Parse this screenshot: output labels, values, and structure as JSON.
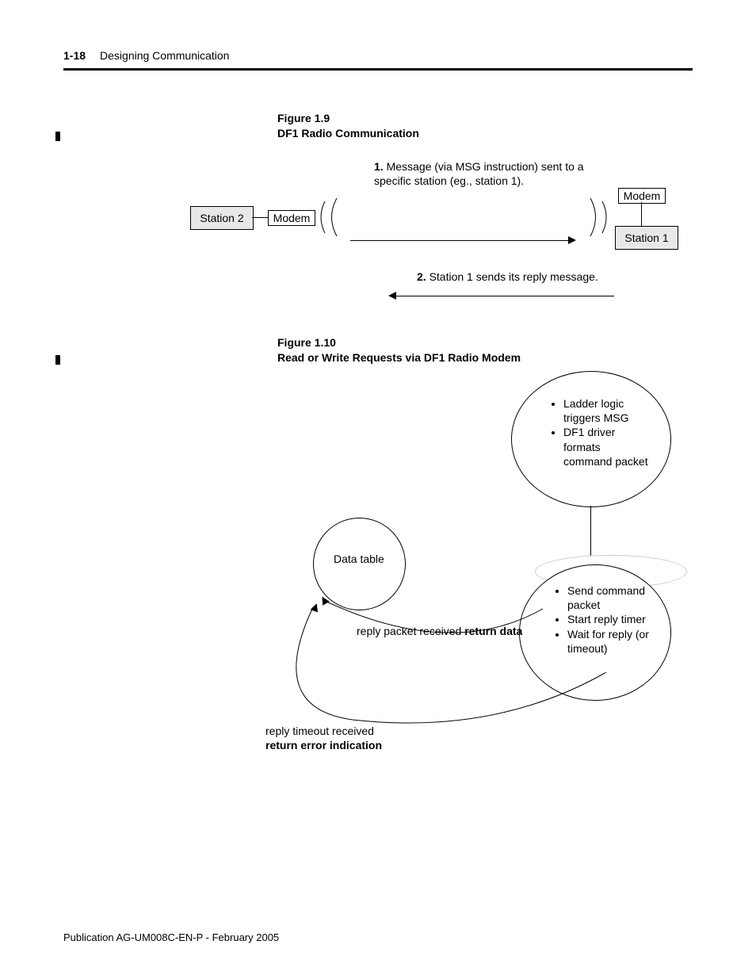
{
  "header": {
    "page": "1-18",
    "section": "Designing Communication"
  },
  "fig19": {
    "label": "Figure 1.9",
    "title": "DF1 Radio Communication",
    "station2": "Station 2",
    "modemL": "Modem",
    "modemR": "Modem",
    "station1": "Station 1",
    "step1_num": "1.",
    "step1_txt": "Message (via MSG instruction) sent to a specific station (eg., station 1).",
    "step2_num": "2.",
    "step2_txt": "Station 1 sends its reply message."
  },
  "fig110": {
    "label": "Figure 1.10",
    "title": "Read or Write Requests via DF1 Radio Modem",
    "node_top": [
      "Ladder logic triggers MSG",
      "DF1 driver formats command packet"
    ],
    "node_right": [
      "Send command packet",
      "Start reply timer",
      "Wait for reply (or timeout)"
    ],
    "node_left": "Data table",
    "edge_mid_a": "reply packet received ",
    "edge_mid_b": "return data",
    "edge_bot_a": "reply timeout received",
    "edge_bot_b": "return error indication"
  },
  "footer": "Publication AG-UM008C-EN-P - February 2005"
}
